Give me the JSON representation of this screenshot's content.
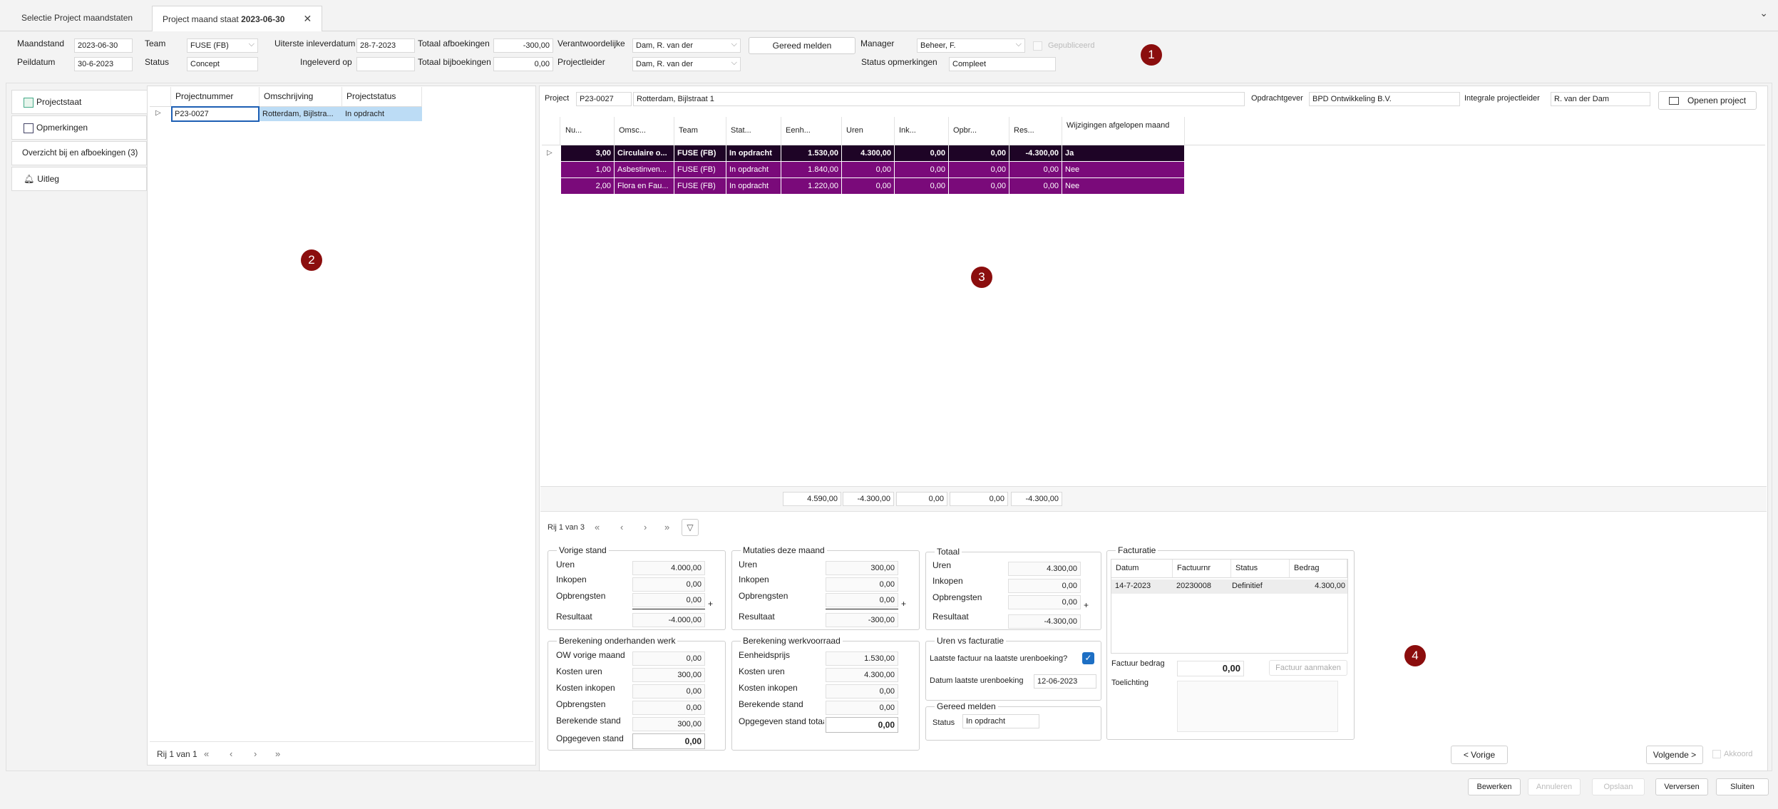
{
  "tabs": [
    {
      "label": "Selectie Project maandstaten"
    },
    {
      "label": "Project maand staat ",
      "bold": "2023-06-30",
      "close": "✕"
    }
  ],
  "header": {
    "maandstand_label": "Maandstand",
    "maandstand": "2023-06-30",
    "peildatum_label": "Peildatum",
    "peildatum": "30-6-2023",
    "team_label": "Team",
    "team": "FUSE (FB)",
    "status_label": "Status",
    "status": "Concept",
    "uiterste_label": "Uiterste inleverdatum",
    "uiterste": "28-7-2023",
    "ingeleverd_label": "Ingeleverd op",
    "ingeleverd": "",
    "afboek_label": "Totaal afboekingen",
    "afboek": "-300,00",
    "bijboek_label": "Totaal bijboekingen",
    "bijboek": "0,00",
    "verantw_label": "Verantwoordelijke",
    "verantw": "Dam, R. van der",
    "projleider_label": "Projectleider",
    "projleider": "Dam, R. van der",
    "gereed_button": "Gereed melden",
    "manager_label": "Manager",
    "manager": "Beheer, F.",
    "gepubliceerd": "Gepubliceerd",
    "statusopm_label": "Status opmerkingen",
    "statusopm": "Compleet"
  },
  "badges": [
    "1",
    "2",
    "3",
    "4"
  ],
  "sidenav": [
    "Projectstaat",
    "Opmerkingen",
    "Overzicht bij en afboekingen (3)",
    "Uitleg"
  ],
  "leftgrid": {
    "headers": [
      "Projectnummer",
      "Omschrijving",
      "Projectstatus"
    ],
    "row": [
      "P23-0027",
      "Rotterdam, Bijlstra...",
      "In opdracht"
    ],
    "pager": "Rij 1 van 1"
  },
  "project": {
    "project_label": "Project",
    "project_nr": "P23-0027",
    "project_name": "Rotterdam, Bijlstraat 1",
    "opdrachtgever_label": "Opdrachtgever",
    "opdrachtgever": "BPD Ontwikkeling B.V.",
    "ipl_label": "Integrale projectleider",
    "ipl": "R. van der Dam",
    "openen": "Openen project"
  },
  "maingrid": {
    "headers": [
      "Nu...",
      "Omsc...",
      "Team",
      "Stat...",
      "Eenh...",
      "Uren",
      "Ink...",
      "Opbr...",
      "Res...",
      "Wijzigingen afgelopen maand"
    ],
    "rows": [
      [
        "3,00",
        "Circulaire o...",
        "FUSE (FB)",
        "In opdracht",
        "1.530,00",
        "4.300,00",
        "0,00",
        "0,00",
        "-4.300,00",
        "Ja"
      ],
      [
        "1,00",
        "Asbestinven...",
        "FUSE (FB)",
        "In opdracht",
        "1.840,00",
        "0,00",
        "0,00",
        "0,00",
        "0,00",
        "Nee"
      ],
      [
        "2,00",
        "Flora en Fau...",
        "FUSE (FB)",
        "In opdracht",
        "1.220,00",
        "0,00",
        "0,00",
        "0,00",
        "0,00",
        "Nee"
      ]
    ],
    "totals": [
      "4.590,00",
      "-4.300,00",
      "0,00",
      "0,00",
      "-4.300,00"
    ],
    "pager": "Rij 1 van 3",
    "colors": {
      "row1": "#1e0426",
      "row2": "#7a0a7a"
    }
  },
  "vorige": {
    "title": "Vorige stand",
    "uren_l": "Uren",
    "uren": "4.000,00",
    "ink_l": "Inkopen",
    "ink": "0,00",
    "opb_l": "Opbrengsten",
    "opb": "0,00",
    "res_l": "Resultaat",
    "res": "-4.000,00"
  },
  "mutaties": {
    "title": "Mutaties deze maand",
    "uren_l": "Uren",
    "uren": "300,00",
    "ink_l": "Inkopen",
    "ink": "0,00",
    "opb_l": "Opbrengsten",
    "opb": "0,00",
    "res_l": "Resultaat",
    "res": "-300,00"
  },
  "totaal": {
    "title": "Totaal",
    "uren_l": "Uren",
    "uren": "4.300,00",
    "ink_l": "Inkopen",
    "ink": "0,00",
    "opb_l": "Opbrengsten",
    "opb": "0,00",
    "res_l": "Resultaat",
    "res": "-4.300,00"
  },
  "ow": {
    "title": "Berekening onderhanden werk",
    "l1": "OW vorige maand",
    "v1": "0,00",
    "l2": "Kosten uren",
    "v2": "300,00",
    "l3": "Kosten inkopen",
    "v3": "0,00",
    "l4": "Opbrengsten",
    "v4": "0,00",
    "l5": "Berekende stand",
    "v5": "300,00",
    "l6": "Opgegeven stand",
    "v6": "0,00"
  },
  "wv": {
    "title": "Berekening werkvoorraad",
    "l1": "Eenheidsprijs",
    "v1": "1.530,00",
    "l2": "Kosten uren",
    "v2": "4.300,00",
    "l3": "Kosten inkopen",
    "v3": "0,00",
    "l4": "Berekende stand",
    "v4": "0,00",
    "l5": "Opgegeven stand totaa",
    "v5": "0,00"
  },
  "uvf": {
    "title": "Uren vs facturatie",
    "l1": "Laatste factuur na laatste urenboeking?",
    "l2": "Datum laatste urenboeking",
    "v2": "12-06-2023"
  },
  "gm": {
    "title": "Gereed melden",
    "status_l": "Status",
    "status": "In opdracht"
  },
  "facturatie": {
    "title": "Facturatie",
    "headers": [
      "Datum",
      "Factuurnr",
      "Status",
      "Bedrag"
    ],
    "row": [
      "14-7-2023",
      "20230008",
      "Definitief",
      "4.300,00"
    ],
    "bedrag_l": "Factuur bedrag",
    "bedrag": "0,00",
    "aanmaken": "Factuur aanmaken",
    "toel_l": "Toelichting"
  },
  "nav": {
    "vorige": "< Vorige",
    "volgende": "Volgende >",
    "akkoord": "Akkoord"
  },
  "footer": {
    "bewerken": "Bewerken",
    "annuleren": "Annuleren",
    "opslaan": "Opslaan",
    "verversen": "Verversen",
    "sluiten": "Sluiten"
  }
}
